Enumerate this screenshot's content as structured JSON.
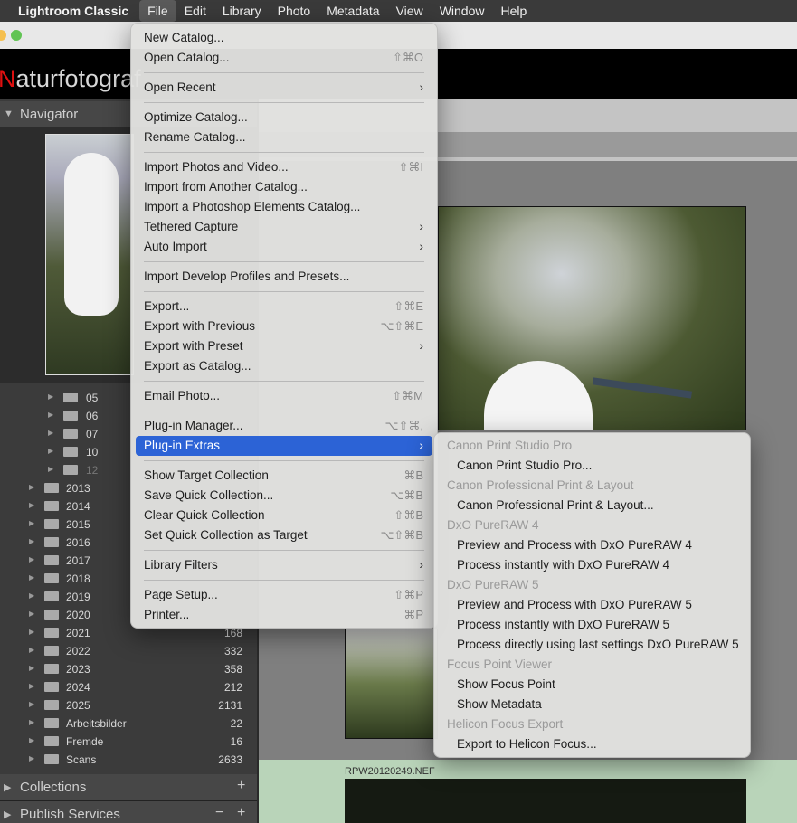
{
  "menubar": {
    "app_name": "Lightroom Classic",
    "items": [
      "File",
      "Edit",
      "Library",
      "Photo",
      "Metadata",
      "View",
      "Window",
      "Help"
    ]
  },
  "identity_plate": {
    "first_letter": "N",
    "rest": "aturfotograf"
  },
  "left_panel": {
    "navigator_title": "Navigator",
    "folders": [
      {
        "name": "05",
        "count": ""
      },
      {
        "name": "06",
        "count": ""
      },
      {
        "name": "07",
        "count": ""
      },
      {
        "name": "10",
        "count": ""
      },
      {
        "name": "12",
        "count": ""
      },
      {
        "name": "2013",
        "count": ""
      },
      {
        "name": "2014",
        "count": ""
      },
      {
        "name": "2015",
        "count": ""
      },
      {
        "name": "2016",
        "count": ""
      },
      {
        "name": "2017",
        "count": ""
      },
      {
        "name": "2018",
        "count": ""
      },
      {
        "name": "2019",
        "count": ""
      },
      {
        "name": "2020",
        "count": ""
      },
      {
        "name": "2021",
        "count": "168"
      },
      {
        "name": "2022",
        "count": "332"
      },
      {
        "name": "2023",
        "count": "358"
      },
      {
        "name": "2024",
        "count": "212"
      },
      {
        "name": "2025",
        "count": "2131"
      },
      {
        "name": "Arbeitsbilder",
        "count": "22"
      },
      {
        "name": "Fremde",
        "count": "16"
      },
      {
        "name": "Scans",
        "count": "2633"
      }
    ],
    "collections_title": "Collections",
    "publish_title": "Publish Services",
    "add_symbol": "+",
    "remove_symbol": "−"
  },
  "main": {
    "file_name": "RPW20120249.NEF"
  },
  "file_menu": {
    "items": [
      {
        "label": "New Catalog...",
        "shortcut": ""
      },
      {
        "label": "Open Catalog...",
        "shortcut": "⇧⌘O"
      },
      {
        "label": "Open Recent",
        "shortcut": ""
      },
      {
        "label": "Optimize Catalog...",
        "shortcut": ""
      },
      {
        "label": "Rename Catalog...",
        "shortcut": ""
      },
      {
        "label": "Import Photos and Video...",
        "shortcut": "⇧⌘I"
      },
      {
        "label": "Import from Another Catalog...",
        "shortcut": ""
      },
      {
        "label": "Import a Photoshop Elements Catalog...",
        "shortcut": ""
      },
      {
        "label": "Tethered Capture",
        "shortcut": ""
      },
      {
        "label": "Auto Import",
        "shortcut": ""
      },
      {
        "label": "Import Develop Profiles and Presets...",
        "shortcut": ""
      },
      {
        "label": "Export...",
        "shortcut": "⇧⌘E"
      },
      {
        "label": "Export with Previous",
        "shortcut": "⌥⇧⌘E"
      },
      {
        "label": "Export with Preset",
        "shortcut": ""
      },
      {
        "label": "Export as Catalog...",
        "shortcut": ""
      },
      {
        "label": "Email Photo...",
        "shortcut": "⇧⌘M"
      },
      {
        "label": "Plug-in Manager...",
        "shortcut": "⌥⇧⌘,"
      },
      {
        "label": "Plug-in Extras",
        "shortcut": ""
      },
      {
        "label": "Show Target Collection",
        "shortcut": "⌘B"
      },
      {
        "label": "Save Quick Collection...",
        "shortcut": "⌥⌘B"
      },
      {
        "label": "Clear Quick Collection",
        "shortcut": "⇧⌘B"
      },
      {
        "label": "Set Quick Collection as Target",
        "shortcut": "⌥⇧⌘B"
      },
      {
        "label": "Library Filters",
        "shortcut": ""
      },
      {
        "label": "Page Setup...",
        "shortcut": "⇧⌘P"
      },
      {
        "label": "Printer...",
        "shortcut": "⌘P"
      }
    ]
  },
  "plugin_extras_menu": {
    "groups": [
      {
        "header": "Canon Print Studio Pro",
        "items": [
          "Canon Print Studio Pro..."
        ]
      },
      {
        "header": "Canon Professional Print & Layout",
        "items": [
          "Canon Professional Print & Layout..."
        ]
      },
      {
        "header": "DxO PureRAW 4",
        "items": [
          "Preview and Process with DxO PureRAW 4",
          "Process instantly with DxO PureRAW 4"
        ]
      },
      {
        "header": "DxO PureRAW 5",
        "items": [
          "Preview and Process with DxO PureRAW 5",
          "Process instantly with DxO PureRAW 5",
          "Process directly using last settings DxO PureRAW 5"
        ]
      },
      {
        "header": "Focus Point Viewer",
        "items": [
          "Show Focus Point",
          "Show Metadata"
        ]
      },
      {
        "header": "Helicon Focus Export",
        "items": [
          "Export to Helicon Focus..."
        ]
      }
    ]
  }
}
